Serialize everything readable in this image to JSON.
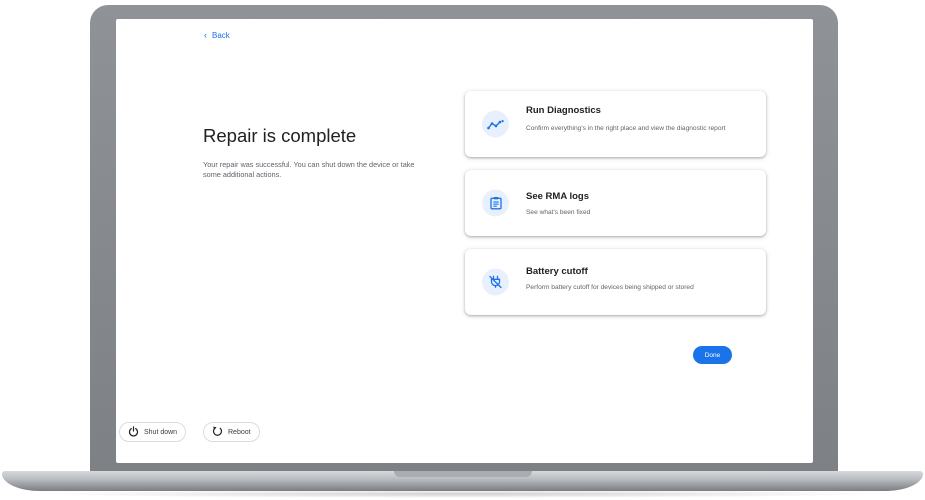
{
  "nav": {
    "back_label": "Back"
  },
  "main": {
    "title": "Repair is complete",
    "description": "Your repair was successful. You can shut down the device or take some additional actions."
  },
  "cards": [
    {
      "title": "Run Diagnostics",
      "subtitle": "Confirm everything's in the right place and view the diagnostic report",
      "icon": "diagnostics-icon"
    },
    {
      "title": "See RMA logs",
      "subtitle": "See what's been fixed",
      "icon": "clipboard-icon"
    },
    {
      "title": "Battery cutoff",
      "subtitle": "Perform battery cutoff for devices being shipped or stored",
      "icon": "power-plug-off-icon"
    }
  ],
  "actions": {
    "done_label": "Done"
  },
  "footer": {
    "shutdown_label": "Shut down",
    "shutdown_icon": "power-icon",
    "reboot_label": "Reboot",
    "reboot_icon": "reboot-icon"
  },
  "colors": {
    "accent": "#1a73e8",
    "icon_bg": "#e8f0fe",
    "title_text": "#202124",
    "body_text": "#5f6368"
  }
}
